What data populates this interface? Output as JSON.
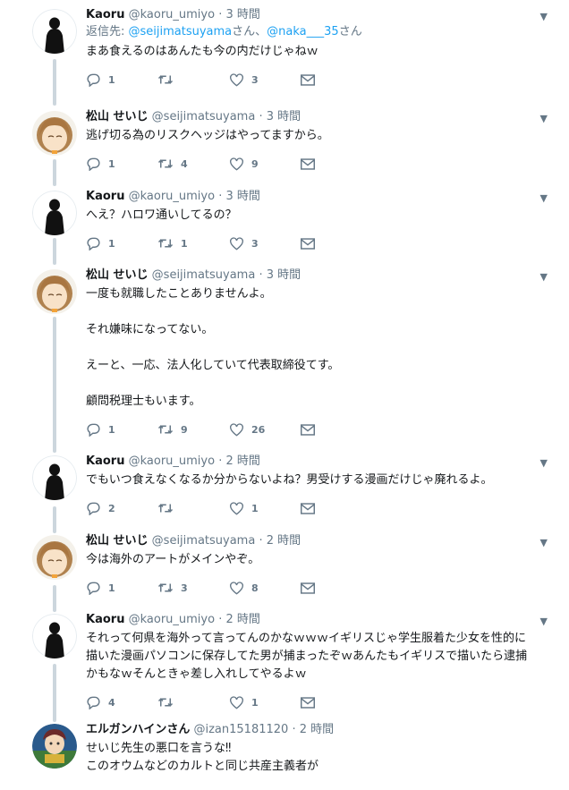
{
  "tweets": [
    {
      "name": "Kaoru",
      "handle": "@kaoru_umiyo",
      "dot": "·",
      "time": "3 時間",
      "reply_prefix": "返信先: ",
      "reply_a": "@seijimatsuyama",
      "reply_mid": "さん、",
      "reply_b": "@naka___35",
      "reply_suffix": "さん",
      "lines": [
        "まあ食えるのはあんたも今の内だけじゃねｗ"
      ],
      "replies": "1",
      "retweets": "",
      "likes": "3",
      "avatar": "kaoru"
    },
    {
      "name": "松山 せいじ",
      "handle": "@seijimatsuyama",
      "dot": "·",
      "time": "3 時間",
      "lines": [
        "逃げ切る為のリスクヘッジはやってますから。"
      ],
      "replies": "1",
      "retweets": "4",
      "likes": "9",
      "avatar": "seiji"
    },
    {
      "name": "Kaoru",
      "handle": "@kaoru_umiyo",
      "dot": "·",
      "time": "3 時間",
      "lines": [
        "へえ？ハロワ通いしてるの？"
      ],
      "replies": "1",
      "retweets": "1",
      "likes": "3",
      "avatar": "kaoru"
    },
    {
      "name": "松山 せいじ",
      "handle": "@seijimatsuyama",
      "dot": "·",
      "time": "3 時間",
      "lines": [
        "一度も就職したことありませんよ。",
        "それ嫌味になってない。",
        "えーと、一応、法人化していて代表取締役てす。",
        "顧問税理士もいます。"
      ],
      "replies": "1",
      "retweets": "9",
      "likes": "26",
      "avatar": "seiji"
    },
    {
      "name": "Kaoru",
      "handle": "@kaoru_umiyo",
      "dot": "·",
      "time": "2 時間",
      "lines": [
        "でもいつ食えなくなるか分からないよね？男受けする漫画だけじゃ廃れるよ。"
      ],
      "replies": "2",
      "retweets": "",
      "likes": "1",
      "avatar": "kaoru"
    },
    {
      "name": "松山 せいじ",
      "handle": "@seijimatsuyama",
      "dot": "·",
      "time": "2 時間",
      "lines": [
        "今は海外のアートがメインやぞ。"
      ],
      "replies": "1",
      "retweets": "3",
      "likes": "8",
      "avatar": "seiji"
    },
    {
      "name": "Kaoru",
      "handle": "@kaoru_umiyo",
      "dot": "·",
      "time": "2 時間",
      "lines": [
        "それって何県を海外って言ってんのかなｗｗｗイギリスじゃ学生服着た少女を性的に描いた漫画パソコンに保存してた男が捕まったぞｗあんたもイギリスで描いたら逮捕かもなｗそんときゃ差し入れしてやるよｗ"
      ],
      "replies": "4",
      "retweets": "",
      "likes": "1",
      "avatar": "kaoru"
    },
    {
      "name": "エルガンハインさん",
      "handle": "@izan15181120",
      "dot": "·",
      "time": "2 時間",
      "lines": [
        "せいじ先生の悪口を言うな‼",
        "このオウムなどのカルトと同じ共産主義者が"
      ],
      "replies": "",
      "retweets": "",
      "likes": "",
      "avatar": "izan"
    }
  ],
  "icons": {
    "caret": "chevron-down-icon",
    "reply": "reply-icon",
    "retweet": "retweet-icon",
    "like": "heart-icon",
    "dm": "envelope-icon"
  },
  "colors": {
    "link": "#1da1f2",
    "muted": "#657786",
    "connector": "#ccd6dd"
  }
}
